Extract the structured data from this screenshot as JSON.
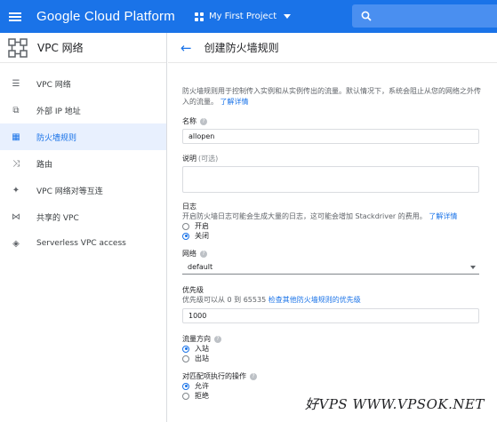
{
  "topbar": {
    "brand": "Google Cloud Platform",
    "project": "My First Project",
    "menu_icon": "hamburger-menu-icon",
    "search_icon": "search-icon"
  },
  "sidebar": {
    "title": "VPC 网络",
    "items": [
      {
        "label": "VPC 网络",
        "icon": "vpc-network-icon"
      },
      {
        "label": "外部 IP 地址",
        "icon": "external-ip-icon"
      },
      {
        "label": "防火墙规则",
        "icon": "firewall-icon",
        "active": true
      },
      {
        "label": "路由",
        "icon": "routes-icon"
      },
      {
        "label": "VPC 网络对等互连",
        "icon": "peering-icon"
      },
      {
        "label": "共享的 VPC",
        "icon": "shared-vpc-icon"
      },
      {
        "label": "Serverless VPC access",
        "icon": "serverless-icon"
      }
    ]
  },
  "main": {
    "title": "创建防火墙规则",
    "description": "防火墙规则用于控制传入实例和从实例传出的流量。默认情况下，系统会阻止从您的网络之外传入的流量。",
    "description_link": "了解详情",
    "name_label": "名称",
    "name_value": "allopen",
    "desc_label": "说明",
    "desc_optional": "(可选)",
    "log_label": "日志",
    "log_desc": "开启防火墙日志可能会生成大量的日志，这可能会增加 Stackdriver 的费用。",
    "log_link": "了解详情",
    "log_on": "开启",
    "log_off": "关闭",
    "network_label": "网络",
    "network_value": "default",
    "priority_label": "优先级",
    "priority_desc": "优先级可以从 0 到 65535",
    "priority_link": "检查其他防火墙规则的优先级",
    "priority_value": "1000",
    "direction_label": "流量方向",
    "direction_in": "入站",
    "direction_out": "出站",
    "action_label": "对匹配项执行的操作",
    "action_allow": "允许",
    "action_deny": "拒绝"
  },
  "watermark": "好VPS WWW.VPSOK.NET",
  "colors": {
    "primary": "#1a73e8",
    "active_bg": "#e8f0fe"
  }
}
